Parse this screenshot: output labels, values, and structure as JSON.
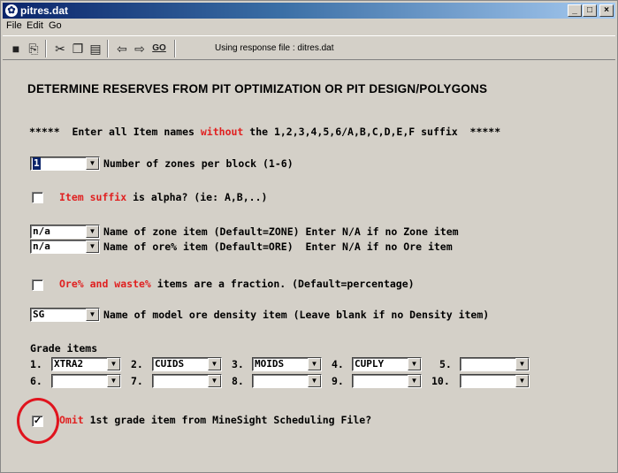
{
  "window": {
    "title": "pitres.dat",
    "controls": {
      "minimize": "_",
      "maximize": "□",
      "close": "×"
    }
  },
  "menu": {
    "items": [
      "File",
      "Edit",
      "Go"
    ]
  },
  "toolbar": {
    "icons": [
      "save-icon",
      "open-icon",
      "cut-icon",
      "copy-icon",
      "paste-icon",
      "back-arrow-icon",
      "forward-arrow-icon",
      "go-icon"
    ],
    "go_label": "GO",
    "response_file": "Using response file : ditres.dat"
  },
  "form": {
    "heading": "DETERMINE RESERVES FROM PIT OPTIMIZATION OR PIT DESIGN/POLYGONS",
    "instruction": {
      "prefix": "*****  Enter all Item names ",
      "emphasis": "without",
      "suffix": " the 1,2,3,4,5,6/A,B,C,D,E,F suffix  *****"
    },
    "zones_per_block": {
      "value": "1",
      "label": "Number of zones per block (1-6)"
    },
    "item_suffix_alpha": {
      "checked": false,
      "label_red": "Item suffix",
      "label_rest": " is alpha? (ie: A,B,..)"
    },
    "zone_item": {
      "value": "n/a",
      "label": "Name of zone item (Default=ZONE) Enter N/A if no Zone item"
    },
    "ore_item": {
      "value": "n/a",
      "label": "Name of ore% item (Default=ORE)  Enter N/A if no Ore item"
    },
    "fraction": {
      "checked": false,
      "label_red": "Ore% and waste%",
      "label_rest": " items are a fraction. (Default=percentage)"
    },
    "density_item": {
      "value": "SG",
      "label": "Name of model ore density item (Leave blank if no Density item)"
    },
    "grade_items": {
      "title": "Grade items",
      "items": [
        {
          "num": "1.",
          "value": "XTRA2"
        },
        {
          "num": "2.",
          "value": "CUIDS"
        },
        {
          "num": "3.",
          "value": "MOIDS"
        },
        {
          "num": "4.",
          "value": "CUPLY"
        },
        {
          "num": "5.",
          "value": ""
        },
        {
          "num": "6.",
          "value": ""
        },
        {
          "num": "7.",
          "value": ""
        },
        {
          "num": "8.",
          "value": ""
        },
        {
          "num": "9.",
          "value": ""
        },
        {
          "num": "10.",
          "value": ""
        }
      ]
    },
    "omit_first": {
      "checked": true,
      "check_mark": "✓",
      "label_red": "Omit",
      "label_rest": " 1st grade item from MineSight Scheduling File?"
    }
  },
  "colors": {
    "highlight_circle": "#e0141e",
    "red_text": "#e02020",
    "titlebar": "#0a246a"
  }
}
